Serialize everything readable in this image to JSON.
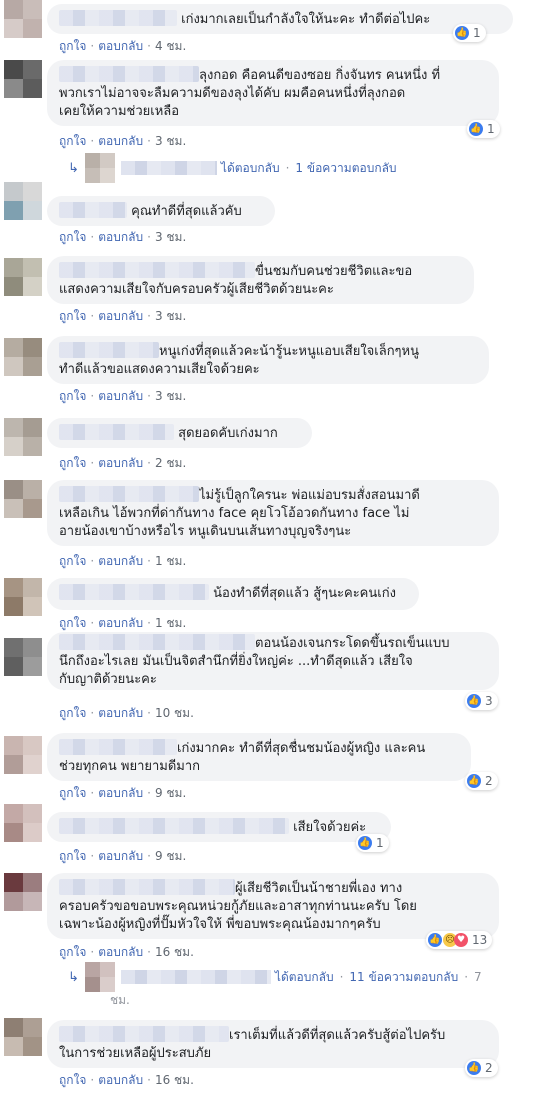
{
  "labels": {
    "like": "ถูกใจ",
    "reply": "ตอบกลับ",
    "replied": "ได้ตอบกลับ",
    "dot": "·"
  },
  "comments": [
    {
      "lines": [
        "เก่งมากเลยเป็นกำลังใจให้นะคะ ทำดีต่อไปคะ"
      ],
      "time": "4 ชม.",
      "reactions": "1"
    },
    {
      "lines": [
        "ลุงกอด คือคนดีของซอย กิ่งจันทร คนหนึ่ง ที่",
        "พวกเราไม่อาจจะลืมความดีของลุงได้คับ ผมคือคนหนึ่งที่ลุงกอด",
        "เคยให้ความช่วยเหลือ"
      ],
      "time": "3 ชม.",
      "reactions": "1",
      "reply_summary": "1 ข้อความตอบกลับ"
    },
    {
      "lines": [
        "คุณทำดีที่สุดแล้วคับ"
      ],
      "time": "3 ชม."
    },
    {
      "lines": [
        "ขื่นชมกับคนช่วยชีวิตและขอ",
        "แสดงความเสียใจกับครอบครัวผู้เสียชีวิตด้วยนะคะ"
      ],
      "time": "3 ชม."
    },
    {
      "lines": [
        "หนูเก่งที่สุดแล้วคะน้ารู้นะหนูแอบเสียใจเล็กๆหนู",
        "ทำดีแล้วขอแสดงความเสียใจด้วยคะ"
      ],
      "time": "3 ชม."
    },
    {
      "lines": [
        "สุดยอดคับเก่งมาก"
      ],
      "time": "2 ชม."
    },
    {
      "lines": [
        "ไม่รู้เป็ลูกใครนะ พ่อแม่อบรมสั่งสอนมาดี",
        "เหลือเกิน ไอ้พวกที่ด่ากันทาง face คุยโวโอ้อวดกันทาง face ไม่",
        "อายน้องเขาบ้างหรือไร หนูเดินบนเส้นทางบุญจริงๆนะ"
      ],
      "time": "1 ชม."
    },
    {
      "lines": [
        "น้องทำดีที่สุดแล้ว สู้ๆนะคะคนเก่ง"
      ],
      "time": "1 ชม."
    },
    {
      "lines": [
        "ตอนน้องเจนกระโดดขึ้นรถเข็นแบบ",
        "นึกถึงอะไรเลย มันเป็นจิตสำนึกที่ยิ่งใหญ่ค่ะ ...ทำดีสุดแล้ว เสียใจ",
        "กับญาติด้วยนะคะ"
      ],
      "time": "10 ชม.",
      "reactions": "3"
    },
    {
      "lines": [
        "เก่งมากคะ ทำดีที่สุดชื่นชมน้องผู้หญิง และคน",
        "ช่วยทุกคน พยายามดีมาก"
      ],
      "time": "9 ชม.",
      "reactions": "2"
    },
    {
      "lines": [
        "เสียใจด้วยค่ะ"
      ],
      "time": "9 ชม.",
      "reactions": "1"
    },
    {
      "lines": [
        "ผู้เสียชีวิตเป็นน้าชายพี่เอง ทาง",
        "ครอบครัวขอขอบพระคุณหน่วยกู้ภัยและอาสาทุกท่านนะครับ โดย",
        "เฉพาะน้องผู้หญิงที่ปั๊มหัวใจให้ พี่ขอบพระคุณน้องมากๆครับ"
      ],
      "time": "16 ชม.",
      "reactions": "13",
      "reply_summary": "11 ข้อความตอบกลับ",
      "reply_time": "7",
      "reply_time_unit": "ชม."
    },
    {
      "lines": [
        "เราเต็มที่แล้วดีที่สุดแล้วครับสู้ต่อไปครับ",
        "ในการช่วยเหลือผู้ประสบภัย"
      ],
      "time": "16 ชม.",
      "reactions": "2"
    }
  ],
  "reply_rows": [
    {
      "summary": "1 ข้อความตอบกลับ"
    },
    {
      "summary": "11 ข้อความตอบกลับ",
      "time": "7",
      "time_cont": "ชม."
    }
  ],
  "colors": {
    "link": "#4267b2",
    "bubble": "#f2f3f5",
    "like": "#3b7cef",
    "meta": "#90949c"
  }
}
